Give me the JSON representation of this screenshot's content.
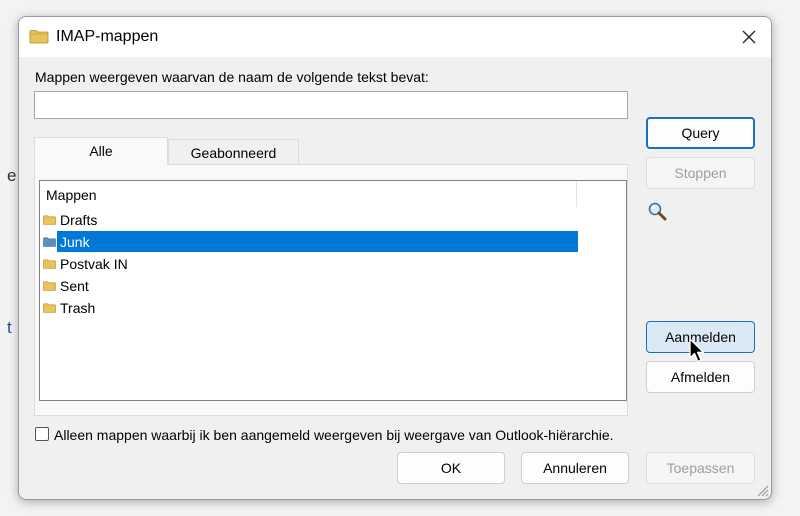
{
  "background": {
    "frag_e": "e",
    "frag_t": "t"
  },
  "dialog": {
    "title": "IMAP-mappen",
    "title_icon": "folder-icon",
    "close_icon": "close-icon",
    "filter_label": "Mappen weergeven waarvan de naam de volgende tekst bevat:",
    "filter_value": "",
    "tabs": [
      {
        "label": "Alle",
        "active": true
      },
      {
        "label": "Geabonneerd",
        "active": false
      }
    ],
    "folder_list": {
      "header": "Mappen",
      "items": [
        {
          "label": "Drafts",
          "selected": false
        },
        {
          "label": "Junk",
          "selected": true
        },
        {
          "label": "Postvak IN",
          "selected": false
        },
        {
          "label": "Sent",
          "selected": false
        },
        {
          "label": "Trash",
          "selected": false
        }
      ]
    },
    "buttons": {
      "query": "Query",
      "stop": "Stoppen",
      "subscribe": "Aanmelden",
      "unsubscribe": "Afmelden",
      "ok": "OK",
      "cancel": "Annuleren",
      "apply": "Toepassen"
    },
    "checkbox_label": "Alleen mappen waarbij ik ben aangemeld weergeven bij weergave van Outlook-hiërarchie.",
    "checkbox_checked": false,
    "colors": {
      "selection": "#0078d7",
      "default_border": "#1e6fc0",
      "folder_yellow": "#e8c35a",
      "folder_selected_blue": "#5b8fbf"
    }
  }
}
